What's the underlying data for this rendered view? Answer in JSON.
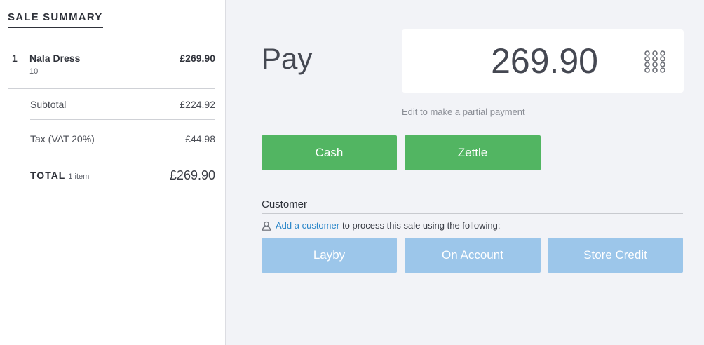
{
  "sidebar": {
    "title": "SALE SUMMARY",
    "line_items": [
      {
        "qty": "1",
        "name": "Nala Dress",
        "variant": "10",
        "price": "£269.90"
      }
    ],
    "subtotal_label": "Subtotal",
    "subtotal_value": "£224.92",
    "tax_label": "Tax (VAT 20%)",
    "tax_value": "£44.98",
    "total_label": "TOTAL",
    "total_items": "1 item",
    "total_value": "£269.90"
  },
  "payment": {
    "title": "Pay",
    "amount": "269.90",
    "hint": "Edit to make a partial payment",
    "keypad_icon": "keypad-icon",
    "methods": [
      {
        "label": "Cash",
        "color": "#52b562"
      },
      {
        "label": "Zettle",
        "color": "#52b562"
      }
    ]
  },
  "customer": {
    "heading": "Customer",
    "icon": "user-icon",
    "link_text": "Add a customer",
    "suffix_text": "to process this sale using the following:",
    "options": [
      {
        "label": "Layby"
      },
      {
        "label": "On Account"
      },
      {
        "label": "Store Credit"
      }
    ],
    "option_color": "#9cc6ea"
  }
}
